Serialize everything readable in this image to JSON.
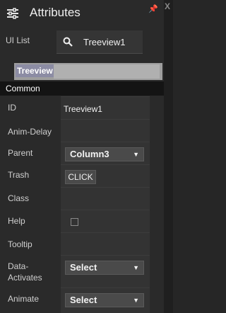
{
  "header": {
    "title": "Attributes",
    "icon": "sliders-icon",
    "pin_icon": "pin-icon",
    "close_glyph": "X"
  },
  "ui_list": {
    "label": "UI List",
    "search_icon": "search-icon",
    "value": "Treeview1"
  },
  "tree_tab": {
    "label": "Treeview"
  },
  "section": {
    "title": "Common"
  },
  "properties": {
    "id": {
      "label": "ID",
      "value": "Treeview1"
    },
    "anim_delay": {
      "label": "Anim-Delay",
      "value": ""
    },
    "parent": {
      "label": "Parent",
      "value": "Column3"
    },
    "trash": {
      "label": "Trash",
      "button": "CLICK"
    },
    "class": {
      "label": "Class",
      "value": ""
    },
    "help": {
      "label": "Help",
      "checked": false
    },
    "tooltip": {
      "label": "Tooltip",
      "value": ""
    },
    "data_activates": {
      "label_line1": "Data-",
      "label_line2": "Activates",
      "value": "Select"
    },
    "animate": {
      "label": "Animate",
      "value": "Select"
    }
  },
  "colors": {
    "panel_bg": "#2a2a2a",
    "section_bg": "#141414",
    "tab_accent": "#8c8ca4"
  }
}
